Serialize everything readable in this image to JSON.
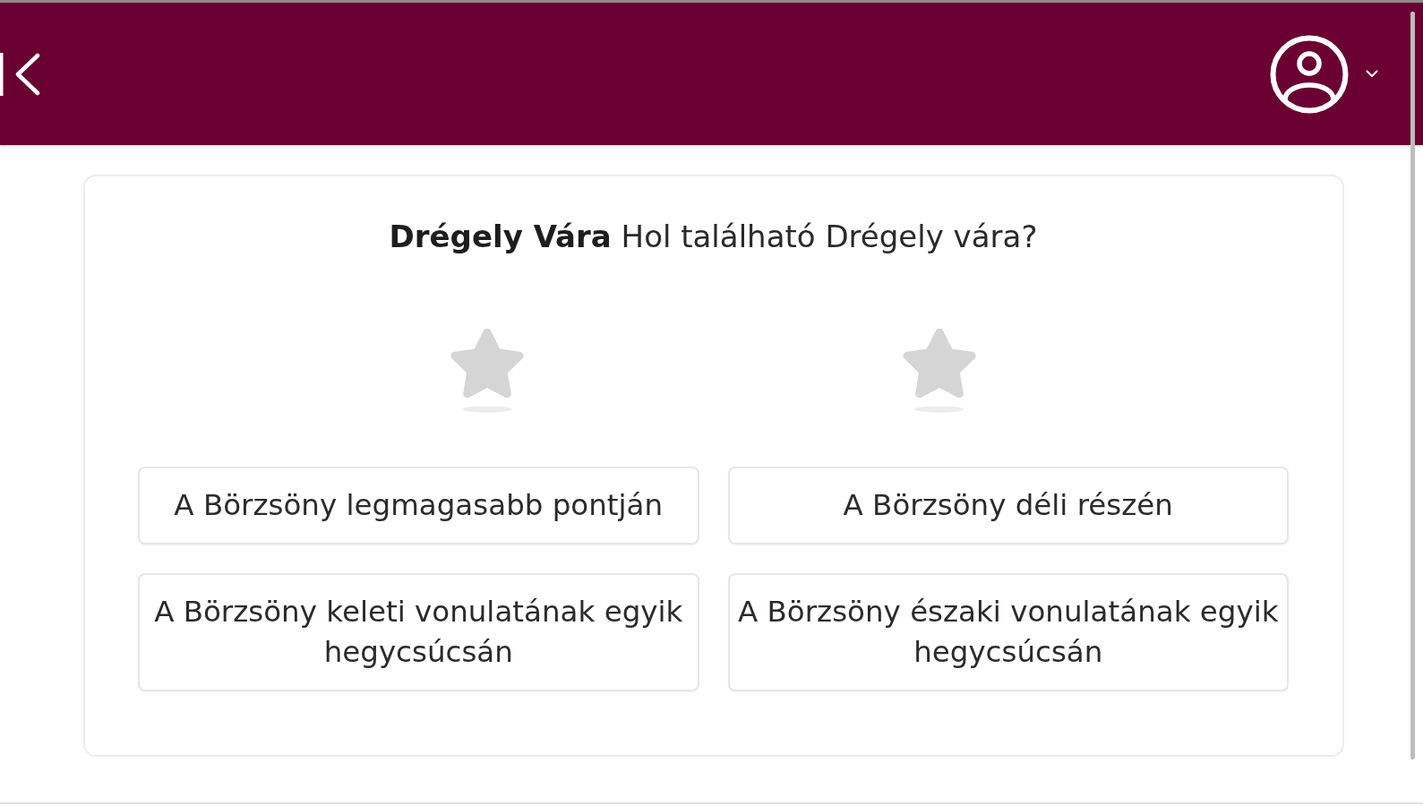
{
  "quiz": {
    "question": "**Drégely Vára** Hol található Drégely vára?",
    "tokens": [
      {
        "filled": false
      },
      {
        "filled": false
      }
    ],
    "answers": [
      {
        "text": "A Börzsöny legmagasabb pontján",
        "selected": false
      },
      {
        "text": "A Börzsöny déli részén",
        "selected": false
      },
      {
        "text": "A Börzsöny keleti vonulatának egyik hegycsúcsán",
        "selected": false
      },
      {
        "text": "A Börzsöny északi vonulatának egyik hegycsúcsán",
        "selected": false
      }
    ]
  }
}
